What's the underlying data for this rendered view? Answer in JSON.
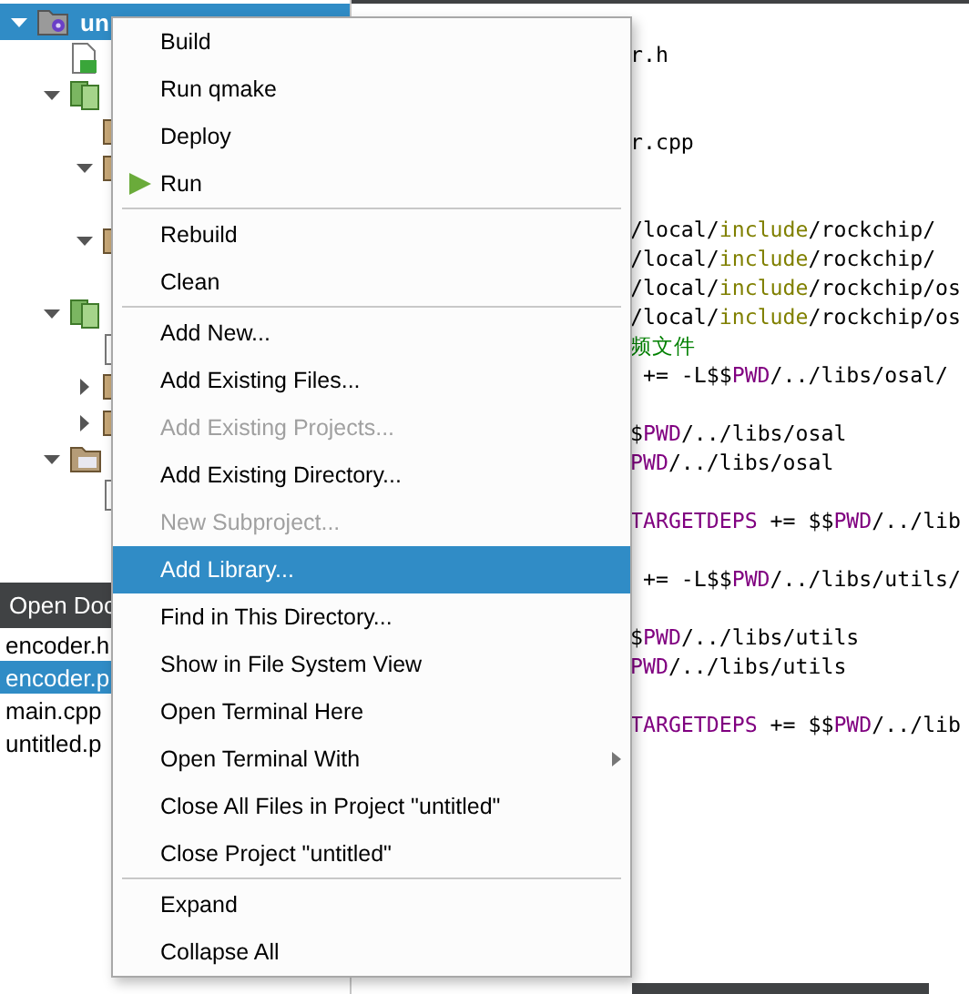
{
  "project_tree": {
    "nodes": [
      {
        "kind": "project",
        "label": "un",
        "selected": true,
        "expanded": true,
        "children": [
          {
            "kind": "qtfile",
            "selected": false
          },
          {
            "kind": "group",
            "selected": false,
            "expanded": true,
            "children": [
              {
                "kind": "folder",
                "selected": false
              },
              {
                "kind": "folder",
                "selected": false,
                "expanded": true,
                "children": [
                  {
                    "selected": false
                  }
                ]
              },
              {
                "kind": "folder",
                "selected": false,
                "expanded": true,
                "children": [
                  {
                    "selected": false
                  }
                ]
              }
            ]
          },
          {
            "kind": "group",
            "selected": false,
            "expanded": true,
            "children": [
              {
                "kind": "file",
                "selected": false
              },
              {
                "kind": "folder",
                "selected": false,
                "expanded": false
              },
              {
                "kind": "folder",
                "selected": false,
                "expanded": false
              }
            ]
          },
          {
            "kind": "cppfolder",
            "selected": false,
            "expanded": true,
            "children": [
              {
                "kind": "file",
                "selected": false
              }
            ]
          }
        ]
      }
    ]
  },
  "open_documents": {
    "title": "Open Doc",
    "items": [
      {
        "label": "encoder.h",
        "selected": false
      },
      {
        "label": "encoder.p",
        "selected": true
      },
      {
        "label": "main.cpp",
        "selected": false
      },
      {
        "label": "untitled.p",
        "selected": false
      }
    ]
  },
  "editor": {
    "lines": [
      {
        "segments": [
          {
            "kind": "text",
            "text": "r.h"
          }
        ]
      },
      {
        "kind": "blank"
      },
      {
        "kind": "blank"
      },
      {
        "segments": [
          {
            "kind": "text",
            "text": "r.cpp"
          }
        ]
      },
      {
        "kind": "blank"
      },
      {
        "kind": "blank"
      },
      {
        "segments": [
          {
            "kind": "text",
            "text": "/local/"
          },
          {
            "kind": "include",
            "text": "include"
          },
          {
            "kind": "text",
            "text": "/rockchip/"
          }
        ]
      },
      {
        "segments": [
          {
            "kind": "text",
            "text": "/local/"
          },
          {
            "kind": "include",
            "text": "include"
          },
          {
            "kind": "text",
            "text": "/rockchip/"
          }
        ]
      },
      {
        "segments": [
          {
            "kind": "text",
            "text": "/local/"
          },
          {
            "kind": "include",
            "text": "include"
          },
          {
            "kind": "text",
            "text": "/rockchip/os"
          }
        ]
      },
      {
        "segments": [
          {
            "kind": "text",
            "text": "/local/"
          },
          {
            "kind": "include",
            "text": "include"
          },
          {
            "kind": "text",
            "text": "/rockchip/os"
          }
        ]
      },
      {
        "segments": [
          {
            "kind": "comment",
            "text": "频文件"
          }
        ]
      },
      {
        "segments": [
          {
            "kind": "text",
            "text": " += -L$$"
          },
          {
            "kind": "keyword",
            "text": "PWD"
          },
          {
            "kind": "text",
            "text": "/../libs/osal/"
          }
        ]
      },
      {
        "kind": "blank"
      },
      {
        "segments": [
          {
            "kind": "text",
            "text": "$"
          },
          {
            "kind": "keyword",
            "text": "PWD"
          },
          {
            "kind": "text",
            "text": "/../libs/osal"
          }
        ]
      },
      {
        "segments": [
          {
            "kind": "keyword",
            "text": "PWD"
          },
          {
            "kind": "text",
            "text": "/../libs/osal"
          }
        ]
      },
      {
        "kind": "blank"
      },
      {
        "segments": [
          {
            "kind": "keyword",
            "text": "TARGETDEPS"
          },
          {
            "kind": "text",
            "text": " += $$"
          },
          {
            "kind": "keyword",
            "text": "PWD"
          },
          {
            "kind": "text",
            "text": "/../lib"
          }
        ]
      },
      {
        "kind": "blank"
      },
      {
        "segments": [
          {
            "kind": "text",
            "text": " += -L$$"
          },
          {
            "kind": "keyword",
            "text": "PWD"
          },
          {
            "kind": "text",
            "text": "/../libs/utils/"
          }
        ]
      },
      {
        "kind": "blank"
      },
      {
        "segments": [
          {
            "kind": "text",
            "text": "$"
          },
          {
            "kind": "keyword",
            "text": "PWD"
          },
          {
            "kind": "text",
            "text": "/../libs/utils"
          }
        ]
      },
      {
        "segments": [
          {
            "kind": "keyword",
            "text": "PWD"
          },
          {
            "kind": "text",
            "text": "/../libs/utils"
          }
        ]
      },
      {
        "kind": "blank"
      },
      {
        "segments": [
          {
            "kind": "keyword",
            "text": "TARGETDEPS"
          },
          {
            "kind": "text",
            "text": " += $$"
          },
          {
            "kind": "keyword",
            "text": "PWD"
          },
          {
            "kind": "text",
            "text": "/../lib"
          }
        ]
      }
    ]
  },
  "context_menu": {
    "items": [
      {
        "kind": "action",
        "label": "Build",
        "disabled": false,
        "selected": false
      },
      {
        "kind": "action",
        "label": "Run qmake",
        "disabled": false,
        "selected": false
      },
      {
        "kind": "action",
        "label": "Deploy",
        "disabled": false,
        "selected": false
      },
      {
        "kind": "run",
        "label": "Run",
        "disabled": false,
        "selected": false
      },
      {
        "kind": "separator"
      },
      {
        "kind": "action",
        "label": "Rebuild",
        "disabled": false,
        "selected": false
      },
      {
        "kind": "action",
        "label": "Clean",
        "disabled": false,
        "selected": false
      },
      {
        "kind": "separator"
      },
      {
        "kind": "action",
        "label": "Add New...",
        "disabled": false,
        "selected": false
      },
      {
        "kind": "action",
        "label": "Add Existing Files...",
        "disabled": false,
        "selected": false
      },
      {
        "kind": "action",
        "label": "Add Existing Projects...",
        "disabled": true,
        "selected": false
      },
      {
        "kind": "action",
        "label": "Add Existing Directory...",
        "disabled": false,
        "selected": false
      },
      {
        "kind": "action",
        "label": "New Subproject...",
        "disabled": true,
        "selected": false
      },
      {
        "kind": "action",
        "label": "Add Library...",
        "disabled": false,
        "selected": true
      },
      {
        "kind": "action",
        "label": "Find in This Directory...",
        "disabled": false,
        "selected": false
      },
      {
        "kind": "action",
        "label": "Show in File System View",
        "disabled": false,
        "selected": false
      },
      {
        "kind": "action",
        "label": "Open Terminal Here",
        "disabled": false,
        "selected": false
      },
      {
        "kind": "submenu",
        "label": "Open Terminal With",
        "disabled": false,
        "selected": false
      },
      {
        "kind": "action",
        "label": "Close All Files in Project \"untitled\"",
        "disabled": false,
        "selected": false
      },
      {
        "kind": "action",
        "label": "Close Project \"untitled\"",
        "disabled": false,
        "selected": false
      },
      {
        "kind": "separator"
      },
      {
        "kind": "action",
        "label": "Expand",
        "disabled": false,
        "selected": false
      },
      {
        "kind": "action",
        "label": "Collapse All",
        "disabled": false,
        "selected": false
      }
    ]
  }
}
